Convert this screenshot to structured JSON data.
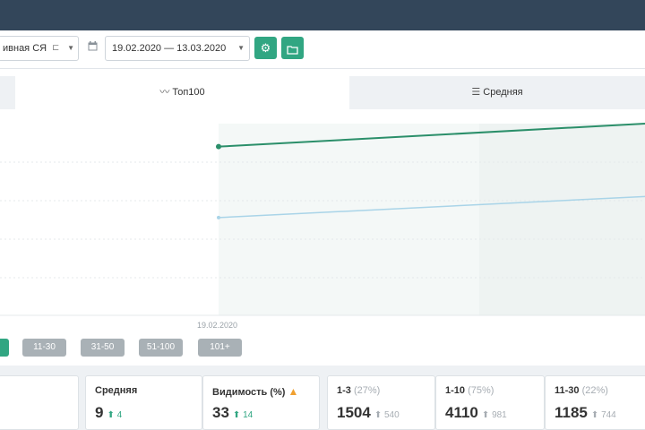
{
  "toolbar": {
    "region_select": "ивная СЯ",
    "date_range": "19.02.2020 — 13.03.2020",
    "settings_icon": "gear-icon",
    "export_icon": "export-icon",
    "calendar_icon": "calendar-icon"
  },
  "tabs": [
    {
      "label": "Топ100",
      "icon": "chart-line-icon",
      "active": true
    },
    {
      "label": "Средняя",
      "icon": "list-icon",
      "active": false
    }
  ],
  "chart": {
    "x_tick_label": "19.02.2020",
    "colors": {
      "primary": "#2b8f6a",
      "secondary": "#a9d4e8",
      "fill": "#f3f7f6"
    },
    "series": [
      {
        "role": "primary",
        "values": [
          0.12,
          0.0
        ]
      },
      {
        "role": "secondary",
        "values": [
          0.49,
          0.38
        ]
      }
    ]
  },
  "filters": {
    "buttons": [
      {
        "label": "",
        "active": true
      },
      {
        "label": "11-30",
        "active": false
      },
      {
        "label": "31-50",
        "active": false
      },
      {
        "label": "51-100",
        "active": false
      },
      {
        "label": "101+",
        "active": false
      }
    ]
  },
  "cards": {
    "avg": {
      "label": "Средняя",
      "value": "9",
      "delta": "4"
    },
    "visibility": {
      "label": "Видимость (%)",
      "value": "33",
      "delta": "14",
      "warning_icon": "warning-icon"
    },
    "top3": {
      "label": "1-3",
      "pct": "(27%)",
      "value": "1504",
      "delta": "540"
    },
    "top10": {
      "label": "1-10",
      "pct": "(75%)",
      "value": "4110",
      "delta": "981"
    },
    "top30": {
      "label": "11-30",
      "pct": "(22%)",
      "value": "1185",
      "delta": "744"
    }
  }
}
